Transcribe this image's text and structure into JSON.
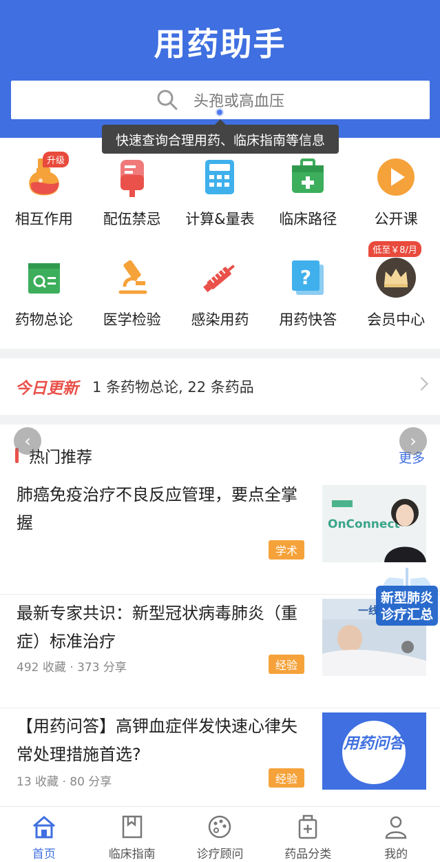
{
  "header": {
    "title": "用药助手",
    "search_placeholder": "头孢或高血压",
    "tooltip": "快速查询合理用药、临床指南等信息"
  },
  "grid": [
    {
      "label": "相互作用",
      "icon": "flask-icon",
      "badge": "升级"
    },
    {
      "label": "配伍禁忌",
      "icon": "iv-bag-icon"
    },
    {
      "label": "计算&量表",
      "icon": "calculator-icon"
    },
    {
      "label": "临床路径",
      "icon": "medkit-icon"
    },
    {
      "label": "公开课",
      "icon": "play-icon"
    },
    {
      "label": "药物总论",
      "icon": "document-icon"
    },
    {
      "label": "医学检验",
      "icon": "microscope-icon"
    },
    {
      "label": "感染用药",
      "icon": "syringe-icon"
    },
    {
      "label": "用药快答",
      "icon": "question-icon"
    },
    {
      "label": "会员中心",
      "icon": "crown-icon",
      "badge": "低至￥8/月"
    }
  ],
  "update": {
    "tag": "今日更新",
    "text": "1 条药物总论, 22 条药品"
  },
  "section": {
    "title": "热门推荐",
    "more": "更多"
  },
  "articles": [
    {
      "title": "肺癌免疫治疗不良反应管理，要点全掌握",
      "meta": "",
      "tag": "学术",
      "thumb_text": "OnConnect"
    },
    {
      "title": "最新专家共识：新型冠状病毒肺炎（重症）标准治疗",
      "meta": "492 收藏  ·  373 分享",
      "tag": "经验",
      "thumb_text": "一线"
    },
    {
      "title": "【用药问答】高钾血症伴发快速心律失常处理措施首选?",
      "meta": "13 收藏  ·  80 分享",
      "tag": "经验",
      "thumb_text": "用药问答"
    }
  ],
  "float_badge": "新型肺炎诊疗汇总",
  "tabs": [
    {
      "label": "首页",
      "icon": "home-icon",
      "active": true
    },
    {
      "label": "临床指南",
      "icon": "book-icon"
    },
    {
      "label": "诊疗顾问",
      "icon": "palette-icon"
    },
    {
      "label": "药品分类",
      "icon": "pill-box-icon"
    },
    {
      "label": "我的",
      "icon": "user-icon"
    }
  ],
  "colors": {
    "primary": "#3f6fe0",
    "accent_red": "#e9514a",
    "tag_orange": "#f5a23a"
  }
}
